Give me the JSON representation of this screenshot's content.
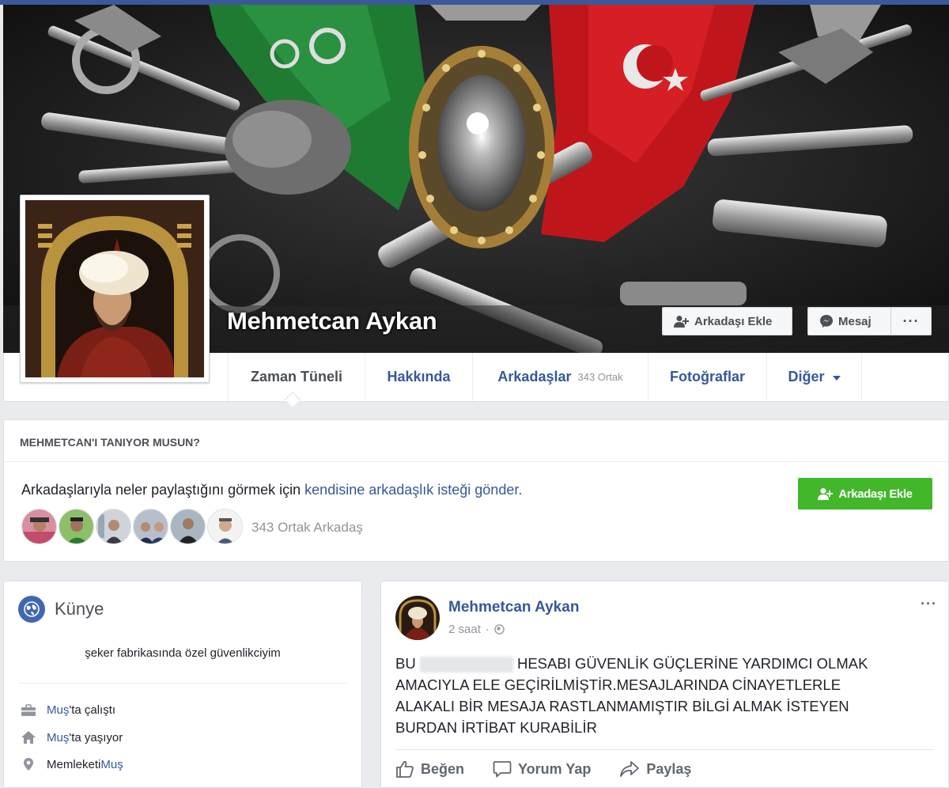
{
  "profile": {
    "name": "Mehmetcan Aykan",
    "add_friend_label": "Arkadaşı Ekle",
    "message_label": "Mesaj",
    "more_label": "···"
  },
  "nav": {
    "tabs": [
      {
        "label": "Zaman Tüneli",
        "active": true
      },
      {
        "label": "Hakkında"
      },
      {
        "label": "Arkadaşlar",
        "sub": "343 Ortak"
      },
      {
        "label": "Fotoğraflar"
      },
      {
        "label": "Diğer"
      }
    ]
  },
  "know_box": {
    "title": "MEHMETCAN'I TANIYOR MUSUN?",
    "text_before": "Arkadaşlarıyla neler paylaştığını görmek için ",
    "text_link": "kendisine arkadaşlık isteği gönder.",
    "add_friend_label": "Arkadaşı Ekle",
    "mutual_friends": "343 Ortak Arkadaş",
    "avatar_count": 6
  },
  "intro": {
    "title": "Künye",
    "bio": "şeker fabrikasında özel güvenlikciyim",
    "items": [
      {
        "icon": "briefcase-icon",
        "link": "Muş",
        "suffix": "'ta çalıştı"
      },
      {
        "icon": "home-icon",
        "link": "Muş",
        "suffix": "'ta yaşıyor"
      },
      {
        "icon": "location-pin-icon",
        "prefix": "Memleketi ",
        "link": "Muş"
      }
    ]
  },
  "post": {
    "author": "Mehmetcan Aykan",
    "time": "2 saat",
    "separator": "·",
    "more": "···",
    "body_line1_start": "BU",
    "body_line1_end": "HESABI GÜVENLİK GÜÇLERİNE YARDIMCI OLMAK",
    "body_line2": "AMACIYLA ELE GEÇİRİLMİŞTİR.MESAJLARINDA CİNAYETLERLE",
    "body_line3": "ALAKALI BİR MESAJA RASTLANMAMIŞTIR BİLGİ ALMAK İSTEYEN",
    "body_line4": "BURDAN İRTİBAT KURABİLİR",
    "actions": {
      "like": "Beğen",
      "comment": "Yorum Yap",
      "share": "Paylaş"
    }
  },
  "colors": {
    "facebook_blue": "#3b5998",
    "link_blue": "#365899",
    "green": "#42b72a"
  }
}
